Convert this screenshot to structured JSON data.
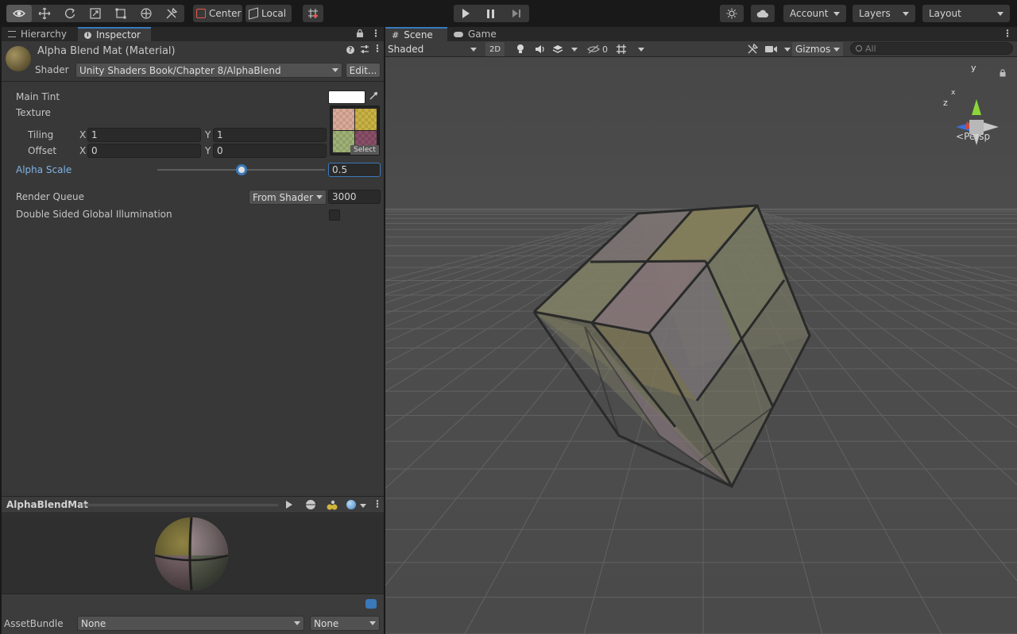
{
  "toolbar": {
    "tools": [
      "view-tool",
      "move-tool",
      "rotate-tool",
      "scale-tool",
      "rect-tool",
      "transform-tool",
      "custom-editor-tool"
    ],
    "pivot_mode": "Center",
    "pivot_rotation": "Local",
    "account_label": "Account",
    "layers_label": "Layers",
    "layout_label": "Layout"
  },
  "left_panel": {
    "tabs": [
      "Hierarchy",
      "Inspector"
    ],
    "material_title": "Alpha Blend Mat (Material)",
    "shader_label": "Shader",
    "shader_value": "Unity Shaders Book/Chapter 8/AlphaBlend",
    "edit_button": "Edit...",
    "main_tint_label": "Main Tint",
    "main_tint_color": "#ffffff",
    "texture_label": "Texture",
    "tiling_label": "Tiling",
    "offset_label": "Offset",
    "x_label": "X",
    "y_label": "Y",
    "tiling_x": "1",
    "tiling_y": "1",
    "offset_x": "0",
    "offset_y": "0",
    "select_label": "Select",
    "alpha_scale_label": "Alpha Scale",
    "alpha_scale_value": "0.5",
    "alpha_scale_fraction": 0.5,
    "render_queue_label": "Render Queue",
    "render_queue_mode": "From Shader",
    "render_queue_value": "3000",
    "dsgi_label": "Double Sided Global Illumination",
    "dsgi_checked": false
  },
  "preview": {
    "title": "AlphaBlendMat"
  },
  "asset_bundle": {
    "label": "AssetBundle",
    "name_value": "None",
    "variant_value": "None"
  },
  "scene": {
    "tabs": [
      "Scene",
      "Game"
    ],
    "draw_mode": "Shaded",
    "mode_2d": "2D",
    "hidden_count": "0",
    "gizmos_label": "Gizmos",
    "search_placeholder": "All",
    "projection_label": "Persp",
    "axis_y": "y",
    "axis_z": "z",
    "axis_x": "x"
  },
  "colors": {
    "accent": "#3a79bb",
    "alpha_label": "#7fb3e6"
  }
}
